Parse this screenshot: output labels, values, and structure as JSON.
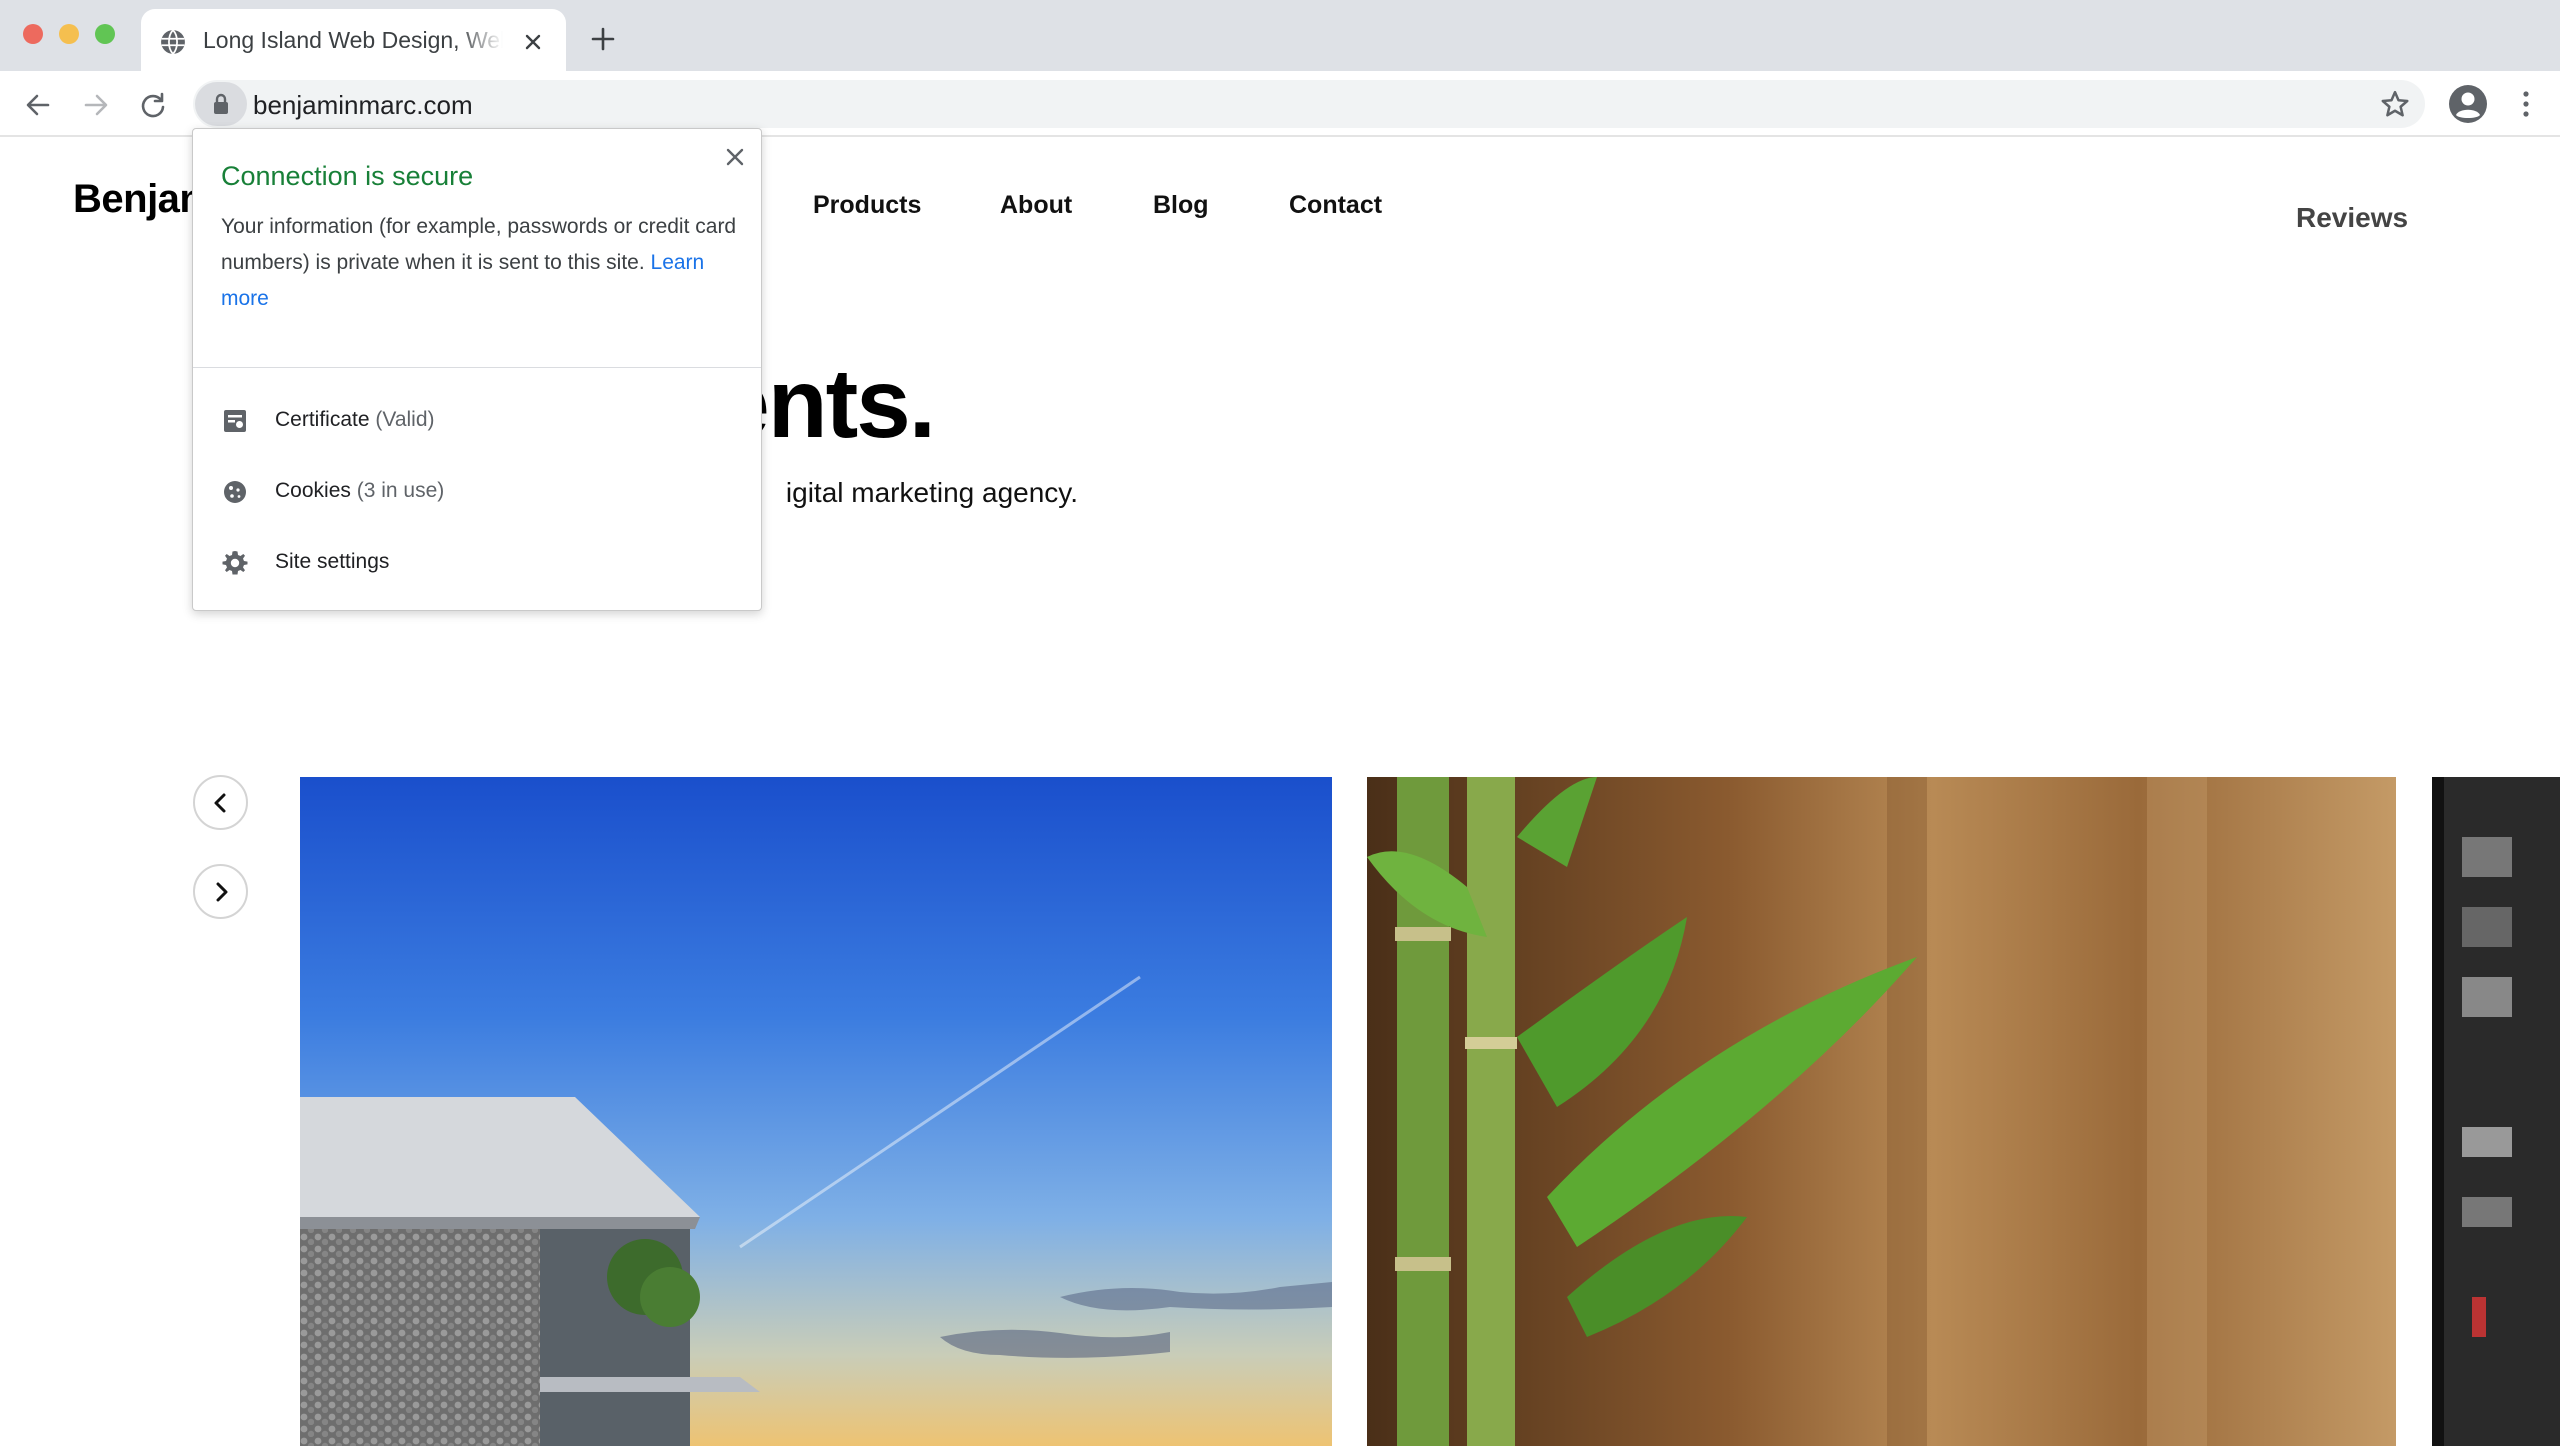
{
  "browser": {
    "tab_title": "Long Island Web Design, Website Design & Development",
    "url": "benjaminmarc.com",
    "icons": [
      "globe-icon",
      "close-icon",
      "plus-icon",
      "back-arrow-icon",
      "forward-arrow-icon",
      "reload-icon",
      "lock-icon",
      "star-icon",
      "profile-icon",
      "kebab-menu-icon"
    ]
  },
  "site": {
    "brand": "Benjamin Marc",
    "nav": {
      "products": "Products",
      "about": "About",
      "blog": "Blog",
      "contact": "Contact",
      "reviews": "Reviews"
    },
    "hero_title_visible": "ents.",
    "hero_subtitle_visible": "igital marketing agency."
  },
  "popup": {
    "title": "Connection is secure",
    "body": "Your information (for example, passwords or credit card numbers) is private when it is sent to this site.",
    "learn_more": "Learn more",
    "certificate_label": "Certificate",
    "certificate_status": "(Valid)",
    "cookies_label": "Cookies",
    "cookies_status": "(3 in use)",
    "site_settings_label": "Site settings",
    "title_color": "#188038",
    "link_color": "#1a73e8"
  }
}
